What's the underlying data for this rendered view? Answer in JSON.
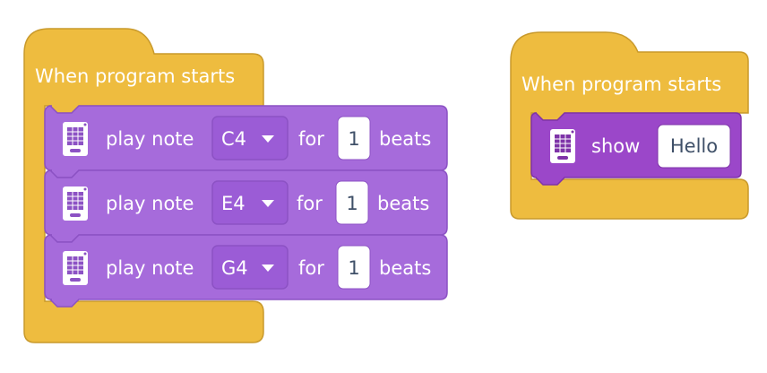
{
  "colors": {
    "events_block": "#EEBC3F",
    "events_stroke": "#C99A2C",
    "sound_block": "#A66BDB",
    "sound_stroke": "#8C52C4",
    "display_block": "#9B47C9",
    "display_stroke": "#7E33A8",
    "dropdown_fill": "#9B5CD6",
    "input_fill": "#FFFFFF",
    "input_text": "#3F5068",
    "block_text": "#FFFFFF"
  },
  "scripts": [
    {
      "hat": {
        "label": "When program starts",
        "icon": "none"
      },
      "blocks": [
        {
          "icon": "hub-icon",
          "label": "play note",
          "note": "C4",
          "dropdown_icon": "caret-down-icon",
          "for_label": "for",
          "beats_value": "1",
          "beats_label": "beats"
        },
        {
          "icon": "hub-icon",
          "label": "play note",
          "note": "E4",
          "dropdown_icon": "caret-down-icon",
          "for_label": "for",
          "beats_value": "1",
          "beats_label": "beats"
        },
        {
          "icon": "hub-icon",
          "label": "play note",
          "note": "G4",
          "dropdown_icon": "caret-down-icon",
          "for_label": "for",
          "beats_value": "1",
          "beats_label": "beats"
        }
      ]
    },
    {
      "hat": {
        "label": "When program starts",
        "icon": "none"
      },
      "blocks": [
        {
          "icon": "hub-icon",
          "label": "show",
          "text_value": "Hello"
        }
      ]
    }
  ]
}
